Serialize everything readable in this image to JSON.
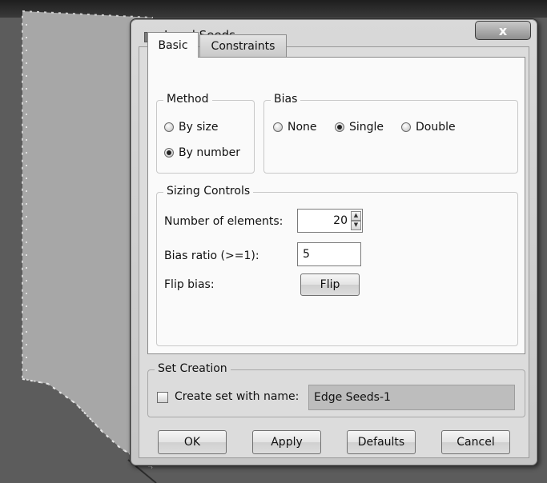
{
  "window": {
    "title": "Local Seeds",
    "close_label": "x"
  },
  "tabs": [
    {
      "label": "Basic",
      "selected": true
    },
    {
      "label": "Constraints",
      "selected": false
    }
  ],
  "method": {
    "title": "Method",
    "options": [
      {
        "label": "By size",
        "checked": false
      },
      {
        "label": "By number",
        "checked": true
      }
    ]
  },
  "bias": {
    "title": "Bias",
    "options": [
      {
        "label": "None",
        "checked": false
      },
      {
        "label": "Single",
        "checked": true
      },
      {
        "label": "Double",
        "checked": false
      }
    ]
  },
  "sizing": {
    "title": "Sizing Controls",
    "num_elements_label": "Number of elements:",
    "num_elements_value": "20",
    "bias_ratio_label": "Bias ratio (>=1):",
    "bias_ratio_value": "5",
    "flip_bias_label": "Flip bias:",
    "flip_button": "Flip"
  },
  "set_creation": {
    "title": "Set Creation",
    "checkbox_label": "Create set with name:",
    "checked": false,
    "name_value": "Edge Seeds-1"
  },
  "buttons": {
    "ok": "OK",
    "apply": "Apply",
    "defaults": "Defaults",
    "cancel": "Cancel"
  },
  "colors": {
    "part_face": "#a7a7a7",
    "viewport_bg": "#5c5c5c",
    "panel_bg": "#fafafa"
  }
}
